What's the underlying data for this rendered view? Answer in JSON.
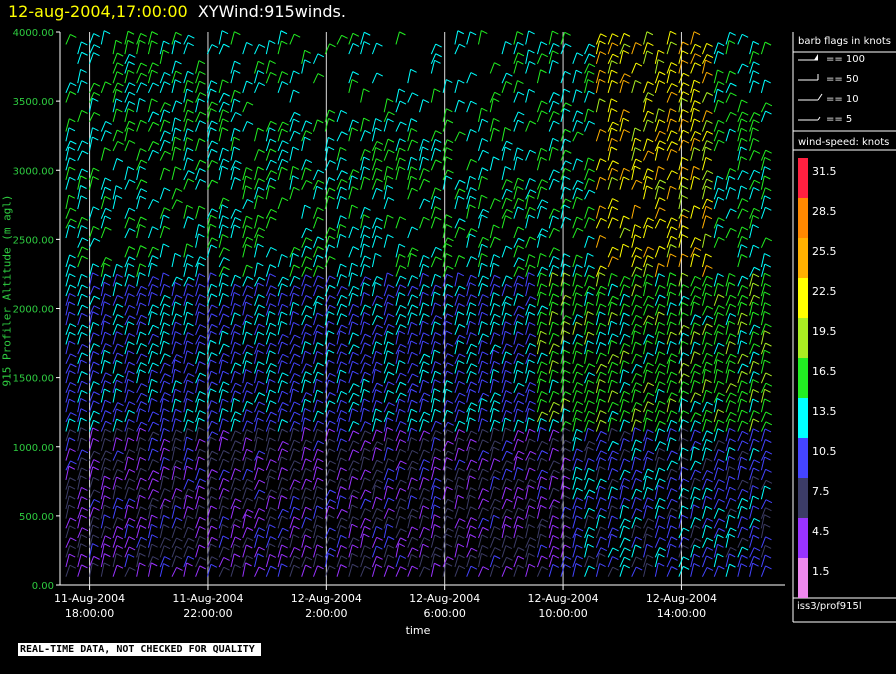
{
  "header": {
    "datetime": "12-aug-2004,17:00:00",
    "product": "XYWind:915winds."
  },
  "legend": {
    "flags_title": "barb flags in knots",
    "flags": [
      "== 100",
      "== 50",
      "== 10",
      "== 5"
    ],
    "colorbar_title": "wind-speed: knots",
    "colorbar": [
      {
        "label": "31.5",
        "color": "#ff2040"
      },
      {
        "label": "28.5",
        "color": "#ff8800"
      },
      {
        "label": "25.5",
        "color": "#ffb000"
      },
      {
        "label": "22.5",
        "color": "#ffff00"
      },
      {
        "label": "19.5",
        "color": "#aaee22"
      },
      {
        "label": "16.5",
        "color": "#22ee22"
      },
      {
        "label": "13.5",
        "color": "#00ffff"
      },
      {
        "label": "10.5",
        "color": "#4444ff"
      },
      {
        "label": "7.5",
        "color": "#3c3c66"
      },
      {
        "label": "4.5",
        "color": "#9933ff"
      },
      {
        "label": "1.5",
        "color": "#ee88ee"
      }
    ]
  },
  "source_label": "iss3/prof915l",
  "notice": "REAL-TIME DATA, NOT CHECKED FOR QUALITY",
  "chart_data": {
    "type": "scatter",
    "title": "XYWind:915winds.",
    "subtitle": "12-aug-2004,17:00:00",
    "xlabel": "time",
    "ylabel": "915 Profiler Altitude (m agl)",
    "ylim": [
      0,
      4000
    ],
    "yticks": [
      "4000.00",
      "3500.00",
      "3000.00",
      "2500.00",
      "2000.00",
      "1500.00",
      "1000.00",
      "500.00",
      "0.00"
    ],
    "xticks": [
      {
        "date": "11-Aug-2004",
        "time": "18:00:00"
      },
      {
        "date": "11-Aug-2004",
        "time": "22:00:00"
      },
      {
        "date": "12-Aug-2004",
        "time": "2:00:00"
      },
      {
        "date": "12-Aug-2004",
        "time": "6:00:00"
      },
      {
        "date": "12-Aug-2004",
        "time": "10:00:00"
      },
      {
        "date": "12-Aug-2004",
        "time": "14:00:00"
      }
    ],
    "xlim_hours_from_first_tick": [
      -1,
      23.5
    ],
    "vertical_grid": true,
    "description": "Wind barbs (knots) plotted by time and altitude, colored by wind speed",
    "speed_units": "knots"
  }
}
